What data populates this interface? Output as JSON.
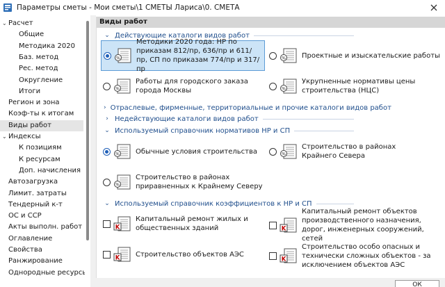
{
  "window": {
    "title": "Параметры сметы - Мои сметы\\1 СМЕТЫ Лариса\\0. СМЕТА"
  },
  "sidebar": {
    "items": [
      {
        "label": "Расчет",
        "expanded": true
      },
      {
        "label": "Общие"
      },
      {
        "label": "Методика 2020"
      },
      {
        "label": "Баз. метод"
      },
      {
        "label": "Рес. метод"
      },
      {
        "label": "Округление"
      },
      {
        "label": "Итоги"
      },
      {
        "label": "Регион и зона"
      },
      {
        "label": "Коэф-ты к итогам"
      },
      {
        "label": "Виды работ",
        "selected": true
      },
      {
        "label": "Индексы",
        "expanded": true
      },
      {
        "label": "К позициям"
      },
      {
        "label": "К ресурсам"
      },
      {
        "label": "Доп. начисления"
      },
      {
        "label": "Автозагрузка"
      },
      {
        "label": "Лимит. затраты"
      },
      {
        "label": "Тендерный к-т"
      },
      {
        "label": "ОС и ССР"
      },
      {
        "label": "Акты выполн. работ"
      },
      {
        "label": "Оглавление"
      },
      {
        "label": "Свойства"
      },
      {
        "label": "Ранжирование"
      },
      {
        "label": "Однородные ресурсы"
      }
    ]
  },
  "main": {
    "header": "Виды работ",
    "sections": {
      "active_catalogs": "Действующие каталоги видов работ",
      "industry_catalogs": "Отраслевые, фирменные, территориальные и прочие каталоги видов работ",
      "inactive_catalogs": "Недействующие каталоги видов работ",
      "norms_reference": "Используемый справочник нормативов НР и СП",
      "coef_reference": "Используемый справочник коэффициентов к НР и СП"
    },
    "active_options": {
      "methods2020": "Методики 2020 года: НР по приказам 812/пр, 636/пр и 611/пр, СП по приказам 774/пр и 317/пр",
      "design_survey": "Проектные и изыскательские работы",
      "moscow": "Работы для городского заказа города Москвы",
      "ncs": "Укрупненные нормативы цены строительства (НЦС)"
    },
    "norms_options": {
      "normal": "Обычные условия строительства",
      "far_north": "Строительство в районах Крайнего Севера",
      "equated_north": "Строительство в районах приравненных к Крайнему Северу"
    },
    "coef_options": {
      "capital_housing": "Капитальный ремонт жилых и общественных зданий",
      "capital_industrial": "Капитальный ремонт объектов производственного назначения, дорог, инженерных сооружений, сетей",
      "npp": "Строительство объектов АЭС",
      "dangerous": "Строительство особо опасных и технически сложных объектов - за исключением объектов АЭС"
    }
  },
  "colors": {
    "accent": "#1f4e8c",
    "selection": "#cce4f7",
    "header_bg": "#d6d6d6",
    "k_icon": "#c00000"
  },
  "footer": {
    "ok_label": "ОК"
  }
}
